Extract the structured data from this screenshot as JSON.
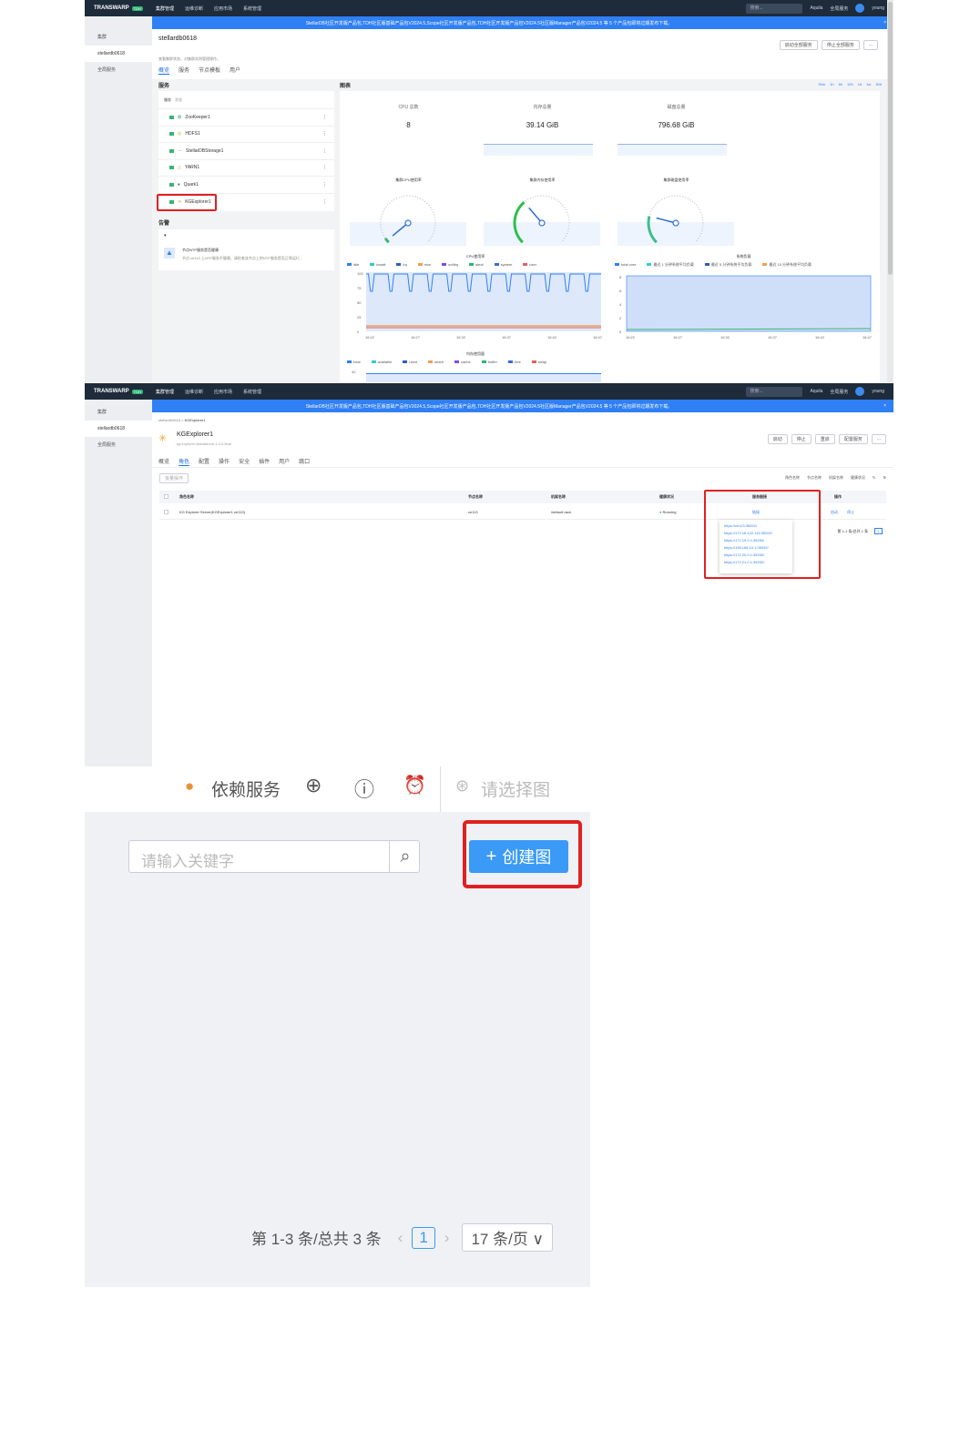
{
  "app": {
    "logo": "TRANSWARP",
    "logo_tag": "TDH",
    "nav": [
      "集群管理",
      "运维诊断",
      "应用市场",
      "系统管理"
    ],
    "search_placeholder": "搜索...",
    "right_items": [
      "Aquila",
      "全局服务",
      "young"
    ]
  },
  "banner": {
    "text": "StellarDB社区开发版产品包,TDH社区版基础产品包V2024.5,Scope社区开发版产品包,TDH社区开发版产品包V2024.5社区版Manager产品包V2024.5 等 5 个产品包即将过期发布下载。"
  },
  "sidebar": {
    "items": [
      "集群",
      "stellardb0618",
      "全局服务"
    ]
  },
  "screen1": {
    "title": "stellardb0618",
    "subtitle": "查看集群状态，对集群实例管理操作。",
    "actions": [
      "启动全部服务",
      "停止全部服务",
      "..."
    ],
    "tabs": [
      "概览",
      "服务",
      "节点模板",
      "用户"
    ],
    "services_heading": "服务",
    "services_filter": [
      "服务",
      "状态"
    ],
    "services": [
      "ZooKeeper1",
      "HDFS1",
      "StellarDBStorage1",
      "YARN1",
      "Quark1",
      "KGExplorer1"
    ],
    "alerts_heading": "告警",
    "alert_title": "节点NTP服务是否健康",
    "alert_desc": "节点 ce113 上NTP服务不健康，请检查该节点上的NTP服务是否正常运行...",
    "charts_heading": "图表",
    "time_ranges": [
      "30m",
      "1h",
      "6h",
      "12h",
      "1d",
      "1w",
      "30d"
    ],
    "metrics": [
      {
        "label": "CPU 总数",
        "value": "8"
      },
      {
        "label": "内存总量",
        "value": "39.14 GiB"
      },
      {
        "label": "磁盘总量",
        "value": "796.68 GiB"
      }
    ],
    "gauges": [
      {
        "label": "集群CPU使用率",
        "level": 0.02
      },
      {
        "label": "集群内存使用率",
        "level": 0.35
      },
      {
        "label": "集群磁盘使用率",
        "level": 0.22
      }
    ],
    "cpu_chart": {
      "title": "CPU使用率",
      "legend": [
        "idle",
        "iowait",
        "irq",
        "nice",
        "softirq",
        "steal",
        "system",
        "user"
      ],
      "yticks": [
        "100",
        "75",
        "50",
        "25",
        "0"
      ],
      "xticks": [
        "16:22",
        "16:27",
        "16:32",
        "16:37",
        "16:42",
        "16:47"
      ]
    },
    "load_chart": {
      "title": "系统负载",
      "legend": [
        "total core",
        "最近 1 分钟系统平均负载",
        "最近 5 分钟系统平均负载",
        "最近 15 分钟系统平均负载"
      ],
      "yticks": [
        "8",
        "6",
        "4",
        "2",
        "0"
      ],
      "xticks": [
        "16:22",
        "16:27",
        "16:32",
        "16:37",
        "16:42",
        "16:47"
      ]
    },
    "mem_chart": {
      "title": "内存使用量",
      "legend": [
        "total",
        "available",
        "used",
        "share",
        "cache",
        "buffer",
        "free",
        "swap"
      ],
      "ytick": "40"
    }
  },
  "screen2": {
    "breadcrumb": [
      "stellardb0618",
      "KGExplorer1"
    ],
    "title": "KGExplorer1",
    "subtitle": "kg-explorer-standalone-1.3.0-final",
    "actions": [
      "启动",
      "停止",
      "重启",
      "配置服务",
      "..."
    ],
    "tabs": [
      "概览",
      "角色",
      "配置",
      "操作",
      "安全",
      "插件",
      "用户",
      "跳口"
    ],
    "batch_button": "批量操作",
    "filters": [
      "角色名称",
      "节点名称",
      "机架名称",
      "健康状况"
    ],
    "columns": [
      "角色名称",
      "节点名称",
      "机架名称",
      "健康状况",
      "服务链接",
      "操作"
    ],
    "row": {
      "role": "KG Explorer Server(KGExplorer1.ce113)",
      "node": "ce113",
      "rack": "/default-rack",
      "health": "Running",
      "link": "链接",
      "ops": [
        "启动",
        "停止"
      ]
    },
    "links": [
      "https://ce113:35292/",
      "https://172.16.122.113:35292/",
      "https://172.19.0.1:35292/",
      "https://198.168.10.1:35292/",
      "https://172.20.0.1:35292/",
      "https://172.21.0.1:35292/"
    ],
    "pagination": "第 1-1 条/总共 1 条",
    "page": "1"
  },
  "zoom": {
    "deps": "依赖服务",
    "select_graph": "请选择图",
    "search_placeholder": "请输入关键字",
    "create_button": "创建图",
    "pagination_text": "第 1-3 条/总共 3 条",
    "page": "1",
    "page_size": "17 条/页"
  },
  "colors": {
    "topbar": "#1d2b3a",
    "banner": "#2f7ff5",
    "accent": "#1e6fe8",
    "highlight": "#e02020",
    "create_button": "#3a9af5"
  }
}
